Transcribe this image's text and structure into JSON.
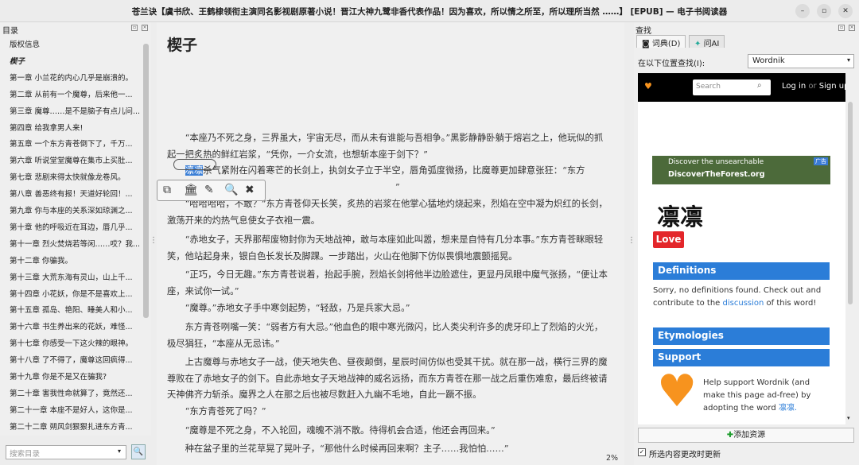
{
  "window": {
    "title": "苍兰诀【虞书欣、王鹤棣领衔主演同名影视剧原著小说！晋江大神九鹭非香代表作品！因为喜欢，所以情之所至，所以理所当然 ……】 [EPUB] — 电子书阅读器",
    "min": "–",
    "max": "▫",
    "close": "✕"
  },
  "toc": {
    "title": "目录",
    "items": [
      "版权信息",
      "楔子",
      "第一章 小兰花的内心几乎是崩溃的。",
      "第二章 从前有一个魔尊，后来他一...",
      "第三章 魔尊……是不是脑子有点儿问...",
      "第四章 给我拿男人来!",
      "第五章 一个东方青苍倒下了，千万...",
      "第六章 听说堂堂魔尊在集市上买肚...",
      "第七章 悲剧来得太快就像龙卷风。",
      "第八章 善恶终有报！天道好轮回！...",
      "第九章 你与本座的关系深如琼渊之...",
      "第十章 他的呼吸近在耳边，唇几乎...",
      "第十一章 烈火焚烧若等闲……哎？我...",
      "第十二章 你骗我。",
      "第十三章 大荒东海有灵山，山上千...",
      "第十四章 小花妖，你是不是喜欢上...",
      "第十五章 孤岛、艳阳、睡美人和小...",
      "第十六章 书生养出来的花妖，难怪...",
      "第十七章 你感受一下这火辣的眼神。",
      "第十八章 了不得了，魔尊这回疯得...",
      "第十九章 你是不是又在骗我?",
      "第二十章 害我性命就算了，竟然还...",
      "第二十一章 本座不是好人，这你是...",
      "第二十二章 朔风剑狠狠扎进东方青..."
    ],
    "search_placeholder": "搜索目录",
    "search_icon": "🔍"
  },
  "reader": {
    "chapter_title": "楔子",
    "paragraphs": [
      "“本座乃不死之身，三界虽大，宇宙无尽，而从未有谁能与吾相争。”黑影静静卧躺于熔岩之上，他玩似的抓起一把炙热的鲜红岩浆，“凭你，一介女流，也想斩本座于剑下？”",
      "凛凛杀气紧附在闪着寒芒的长剑上，执剑女子立于半空，唇角弧度微扬，比魔尊更加肆意张狂：“东方",
      "“哈哈哈哈，不敢？”东方青苍仰天长笑，炙热的岩浆在他掌心猛地灼烧起来，烈焰在空中凝为炽红的长剑，激荡开来的灼热气息使女子衣袍一震。",
      "“赤地女子，天界那帮废物封你为天地战神，敢与本座如此叫嚣，想来是自恃有几分本事。”东方青苍眯眼轻笑，他站起身来，银白色长发长及脚踝。一步踏出，火山在他脚下仿似畏惧地震颤摇晃。",
      "“正巧，今日无趣。”东方青苍说着，抬起手腕，烈焰长剑将他半边脸遮住，更显丹凤眼中魔气张扬，“便让本座，来试你一试。”",
      "“魔尊。”赤地女子手中寒剑起势，“轻敌，乃是兵家大忌。”",
      "东方青苍咧嘴一笑：“弱者方有大忌。”他血色的眼中寒光微闪，比人类尖利许多的虎牙印上了烈焰的火光，极尽狷狂，“本座从无忌讳。”",
      "上古魔尊与赤地女子一战，使天地失色、昼夜颠倒，星辰时间仿似也受其干扰。就在那一战，横行三界的魔尊败在了赤地女子的剑下。自此赤地女子天地战神的威名远扬，而东方青苍在那一战之后重伤难愈，最后终被请天神佛齐力斩杀。魔界之人在那之后也被尽数赶入九幽不毛地，自此一蹶不振。",
      "“东方青苍死了吗？”",
      "“魔尊是不死之身，不入轮回，魂魄不消不散。待得机会合适，他还会再回来。”",
      "种在盆子里的兰花草晃了晃叶子，“那他什么时候再回来啊？主子……我怕怕……”"
    ],
    "selected_text": "凛凛",
    "popup_icons": [
      "⧉",
      "🏛",
      "✎",
      "🔍",
      "✖"
    ],
    "popup_names": [
      "copy-icon",
      "library-icon",
      "pen-icon",
      "search-icon",
      "close-icon"
    ],
    "progress": "2%"
  },
  "lookup": {
    "title": "查找",
    "tabs": [
      "词典(D)",
      "问AI"
    ],
    "location_label": "在以下位置查找(I):",
    "location_value": "Wordnik",
    "wordnik": {
      "search_placeholder": "Search",
      "login": "Log in",
      "or": "or",
      "signup": "Sign up",
      "ad_line1": "Discover the unsearchable",
      "ad_line2": "DiscoverTheForest.org",
      "ad_tag": "广告",
      "word": "凛凛",
      "love": "Love",
      "definitions_title": "Definitions",
      "definitions_text": "Sorry, no definitions found. Check out and contribute to the",
      "discussion_link": "discussion",
      "definitions_tail": "of this word!",
      "etymologies_title": "Etymologies",
      "support_title": "Support",
      "support_text": "Help support Wordnik (and make this page ad-free) by adopting the word",
      "support_word": "凛凛."
    },
    "add_source": "添加资源",
    "auto_update_label": "所选内容更改时更新",
    "auto_update_checked": "✓"
  },
  "colors": {
    "accent": "#2b7dd8",
    "love": "#e3262a"
  }
}
